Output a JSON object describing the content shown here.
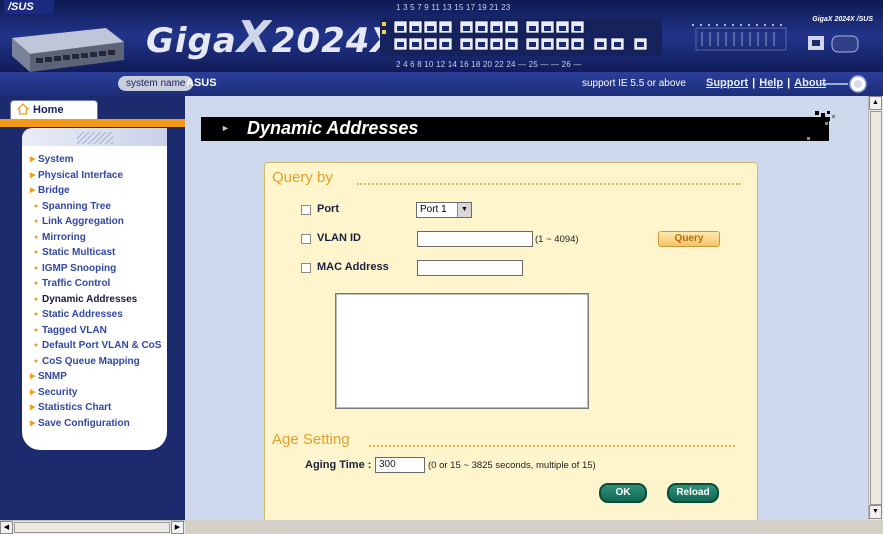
{
  "header": {
    "asus_logo": "/SUS",
    "product_name": "GigaX 2024X",
    "brand_left": "Giga",
    "brand_x": "X",
    "brand_right": "2024X",
    "ports_top_row": "1   3   5   7   9   11   13   15   17   19   21   23",
    "ports_bottom_row": "2   4   6   8   10   12   14   16   18   20   22   24   — 25 — — 26 —",
    "right_brand": "GigaX 2024X /SUS",
    "system_name_label": "system name",
    "system_name_value": "ASUS",
    "support_note": "support IE 5.5 or above",
    "links": [
      "Support",
      "Help",
      "About"
    ]
  },
  "nav": {
    "home_label": "Home",
    "items": [
      {
        "label": "System",
        "level": 0,
        "active": false
      },
      {
        "label": "Physical Interface",
        "level": 0,
        "active": false
      },
      {
        "label": "Bridge",
        "level": 0,
        "active": false
      },
      {
        "label": "Spanning Tree",
        "level": 1,
        "active": false
      },
      {
        "label": "Link Aggregation",
        "level": 1,
        "active": false
      },
      {
        "label": "Mirroring",
        "level": 1,
        "active": false
      },
      {
        "label": "Static Multicast",
        "level": 1,
        "active": false
      },
      {
        "label": "IGMP Snooping",
        "level": 1,
        "active": false
      },
      {
        "label": "Traffic Control",
        "level": 1,
        "active": false
      },
      {
        "label": "Dynamic Addresses",
        "level": 1,
        "active": true
      },
      {
        "label": "Static Addresses",
        "level": 1,
        "active": false
      },
      {
        "label": "Tagged VLAN",
        "level": 1,
        "active": false
      },
      {
        "label": "Default Port VLAN & CoS",
        "level": 1,
        "active": false
      },
      {
        "label": "CoS Queue Mapping",
        "level": 1,
        "active": false
      },
      {
        "label": "SNMP",
        "level": 0,
        "active": false
      },
      {
        "label": "Security",
        "level": 0,
        "active": false
      },
      {
        "label": "Statistics Chart",
        "level": 0,
        "active": false
      },
      {
        "label": "Save Configuration",
        "level": 0,
        "active": false
      }
    ]
  },
  "page": {
    "title": "Dynamic Addresses",
    "query_section": "Query by",
    "port_label": "Port",
    "port_value": "Port 1",
    "vlan_label": "VLAN ID",
    "vlan_value": "",
    "vlan_hint": "(1 ~ 4094)",
    "mac_label": "MAC Address",
    "mac_value": "",
    "query_button": "Query",
    "age_section": "Age Setting",
    "aging_label": "Aging Time :",
    "aging_value": "300",
    "aging_hint": "(0 or 15 ~ 3825 seconds, multiple of 15)",
    "ok_button": "OK",
    "reload_button": "Reload"
  },
  "colors": {
    "accent_orange": "#f39a1a",
    "nav_text": "#3247a5",
    "form_bg": "#fff5cc",
    "button_green": "#136a55",
    "section_title": "#e3a02b"
  }
}
